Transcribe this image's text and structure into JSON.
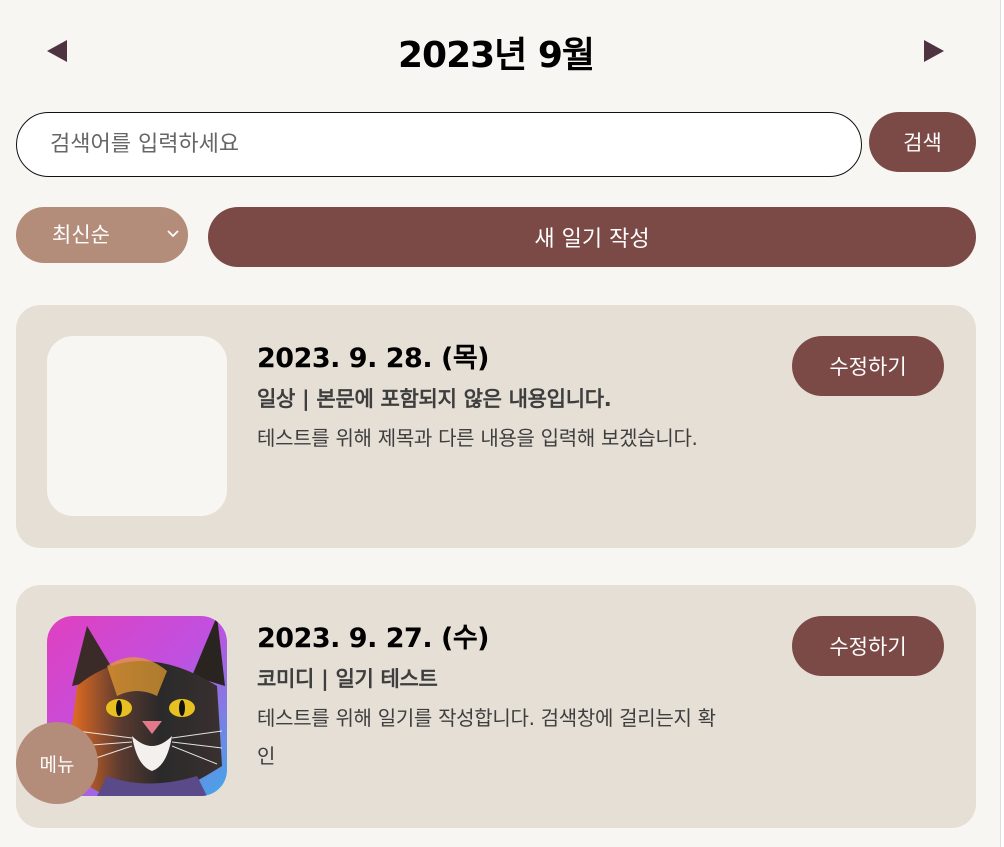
{
  "header": {
    "prev_icon": "triangle-left-icon",
    "next_icon": "triangle-right-icon",
    "month_title": "2023년 9월"
  },
  "search": {
    "placeholder": "검색어를 입력하세요",
    "value": "",
    "button_label": "검색"
  },
  "controls": {
    "sort_selected": "최신순",
    "sort_icon": "chevron-down-icon",
    "new_button_label": "새 일기 작성"
  },
  "entries": [
    {
      "date": "2023. 9. 28. (목)",
      "title": "일상 | 본문에 포함되지 않은 내용입니다.",
      "body": "테스트를 위해 제목과 다른 내용을 입력해 보겠습니다.",
      "edit_label": "수정하기",
      "thumbnail": "empty"
    },
    {
      "date": "2023. 9. 27. (수)",
      "title": "코미디 | 일기 테스트",
      "body": "테스트를 위해 일기를 작성합니다. 검색창에 걸리는지 확인",
      "edit_label": "수정하기",
      "thumbnail": "colorful-cat-image"
    }
  ],
  "menu": {
    "label": "메뉴"
  },
  "colors": {
    "background": "#f8f6f3",
    "card": "#e6dfd6",
    "primary_button": "#7b4a47",
    "secondary_button": "#b38c7a",
    "arrow": "#4e3440"
  }
}
